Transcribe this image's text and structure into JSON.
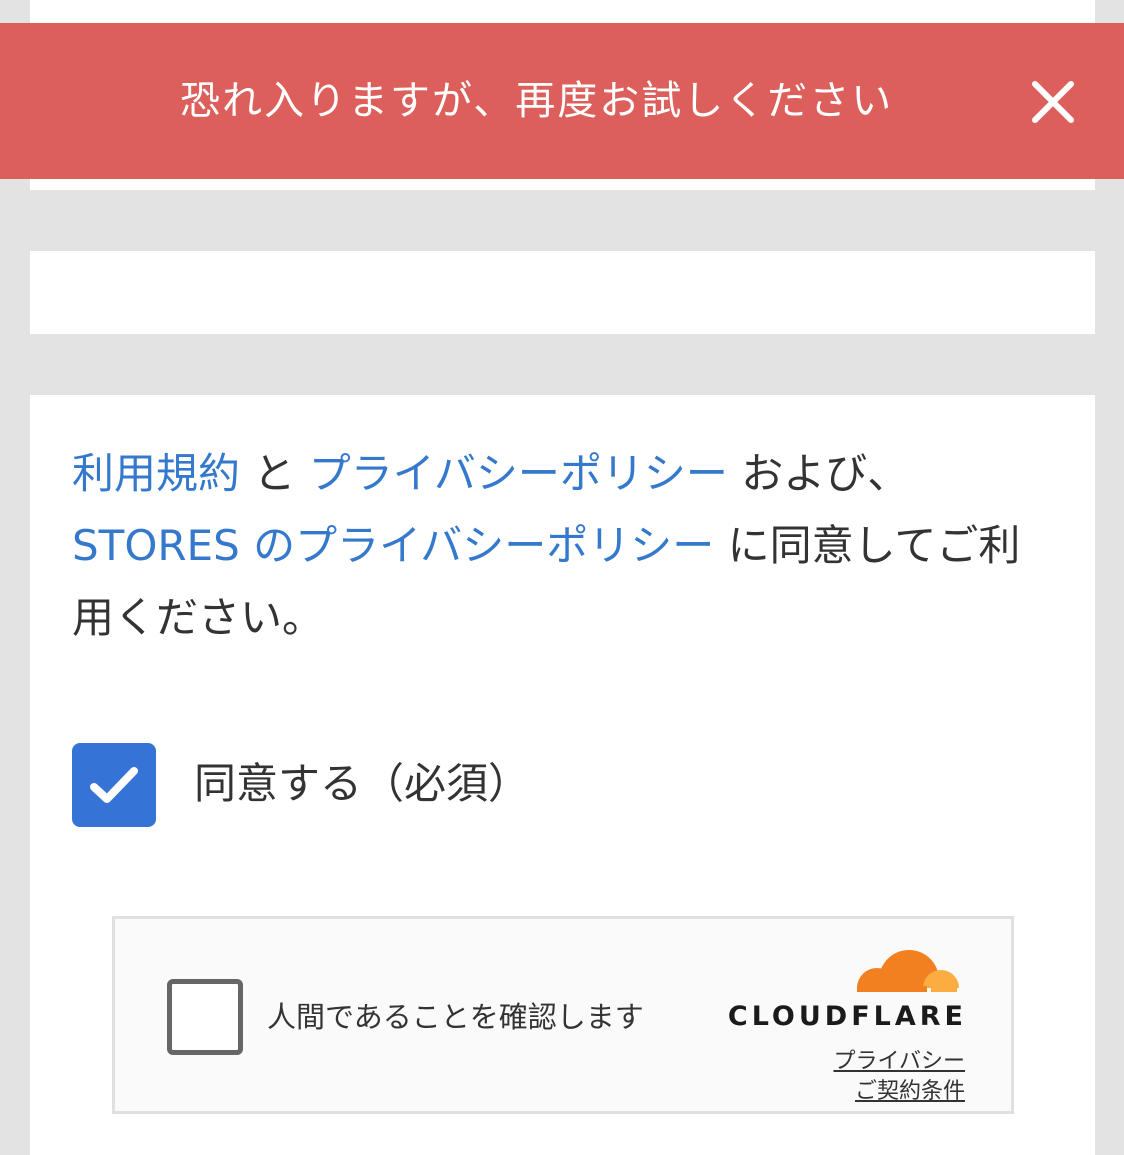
{
  "toast": {
    "message": "恐れ入りますが、再度お試しください",
    "close_icon": "close-icon",
    "background": "#dc5f5c"
  },
  "terms": {
    "link_terms": "利用規約",
    "connector_to": " と ",
    "link_privacy": "プライバシーポリシー",
    "connector_and": " および、",
    "link_stores_privacy": "STORES のプライバシーポリシー",
    "suffix": " に同意してご利用ください。",
    "link_color": "#3479cc"
  },
  "agree": {
    "label": "同意する（必須）",
    "checked": true,
    "icon": "check-icon",
    "color": "#3574d6"
  },
  "captcha": {
    "label": "人間であることを確認します",
    "checked": false,
    "brand": "CLOUDFLARE",
    "logo_icon": "cloudflare-cloud-icon",
    "privacy_link": "プライバシー",
    "terms_link": "ご契約条件",
    "brand_color": "#f38020"
  }
}
